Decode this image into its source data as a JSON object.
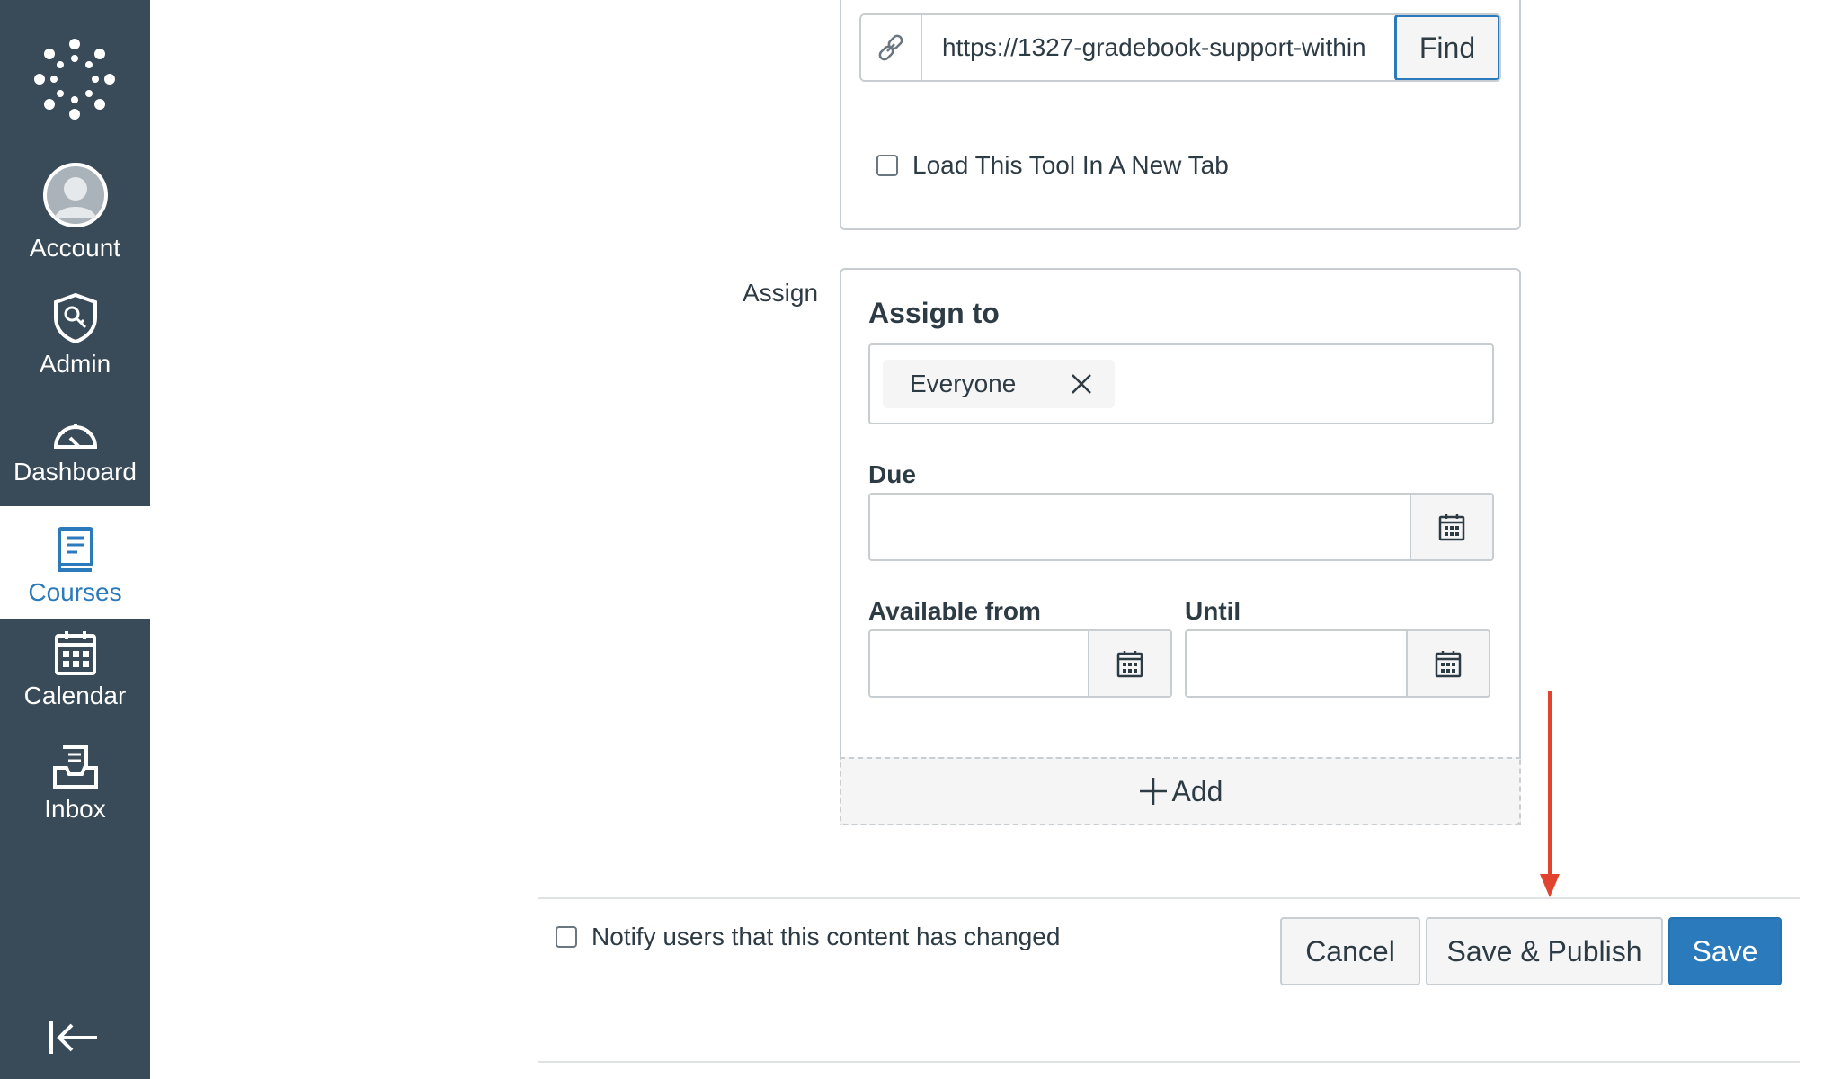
{
  "sidebar": {
    "items": [
      {
        "label": "Account",
        "icon": "avatar-icon"
      },
      {
        "label": "Admin",
        "icon": "admin-shield-icon"
      },
      {
        "label": "Dashboard",
        "icon": "speedometer-icon"
      },
      {
        "label": "Courses",
        "icon": "book-icon",
        "active": true
      },
      {
        "label": "Calendar",
        "icon": "calendar-icon"
      },
      {
        "label": "Inbox",
        "icon": "inbox-icon"
      }
    ],
    "active_color": "#2b7abc",
    "background": "#394b58"
  },
  "external_tool": {
    "url_value": "https://1327-gradebook-support-within",
    "find_label": "Find",
    "new_tab_label": "Load This Tool In A New Tab"
  },
  "assign": {
    "section_label": "Assign",
    "title": "Assign to",
    "assignee_chip": "Everyone",
    "due_label": "Due",
    "due_value": "",
    "available_from_label": "Available from",
    "available_from_value": "",
    "until_label": "Until",
    "until_value": "",
    "add_label": "Add"
  },
  "footer": {
    "notify_label": "Notify users that this content has changed",
    "cancel_label": "Cancel",
    "save_publish_label": "Save & Publish",
    "save_label": "Save"
  },
  "annotation_color": "#e0442e"
}
